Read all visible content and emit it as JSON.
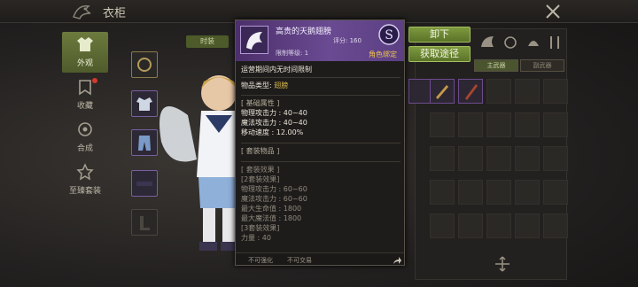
{
  "window": {
    "title": "衣柜"
  },
  "nav": [
    {
      "label": "外观",
      "icon": "outfit-icon",
      "active": true
    },
    {
      "label": "收藏",
      "icon": "collection-icon",
      "badge": true
    },
    {
      "label": "合成",
      "icon": "compose-icon"
    },
    {
      "label": "至臻套装",
      "icon": "supreme-set-icon"
    }
  ],
  "character": {
    "hidden_tab_label": "时装"
  },
  "tooltip": {
    "item_name": "高贵的天鹅翅膀",
    "score_label": "评分: 160",
    "level_label": "限制等级: 1",
    "grade": "S",
    "binding": "角色绑定",
    "time_limit": "运营期间内无时间限制",
    "item_type_label": "物品类型:",
    "item_type_value": "翅膀",
    "basic_attr_title": "[ 基础属性 ]",
    "basic_attrs": [
      "物理攻击力 : 40~40",
      "魔法攻击力 : 40~40",
      "移动速度 : 12.00%"
    ],
    "set_items_title": "[ 套装物品 ]",
    "set_effect_title": "[ 套装效果 ]",
    "set_effects": [
      "[2套装效果]",
      "物理攻击力 : 60~60",
      "魔法攻击力 : 60~60",
      "最大生命值 : 1800",
      "最大魔法值 : 1800",
      "[3套装效果]",
      "力量 : 40"
    ],
    "footer_no_enhance": "不可强化",
    "footer_no_trade": "不可交易"
  },
  "actions": {
    "unequip": "卸下",
    "obtain": "获取途径"
  },
  "right_panel": {
    "sub_tabs": [
      "主武器",
      "副武器"
    ]
  },
  "colors": {
    "accent_green": "#6c7a3e",
    "rare_purple": "#6a4a92",
    "binding_gold": "#f0c64b"
  }
}
